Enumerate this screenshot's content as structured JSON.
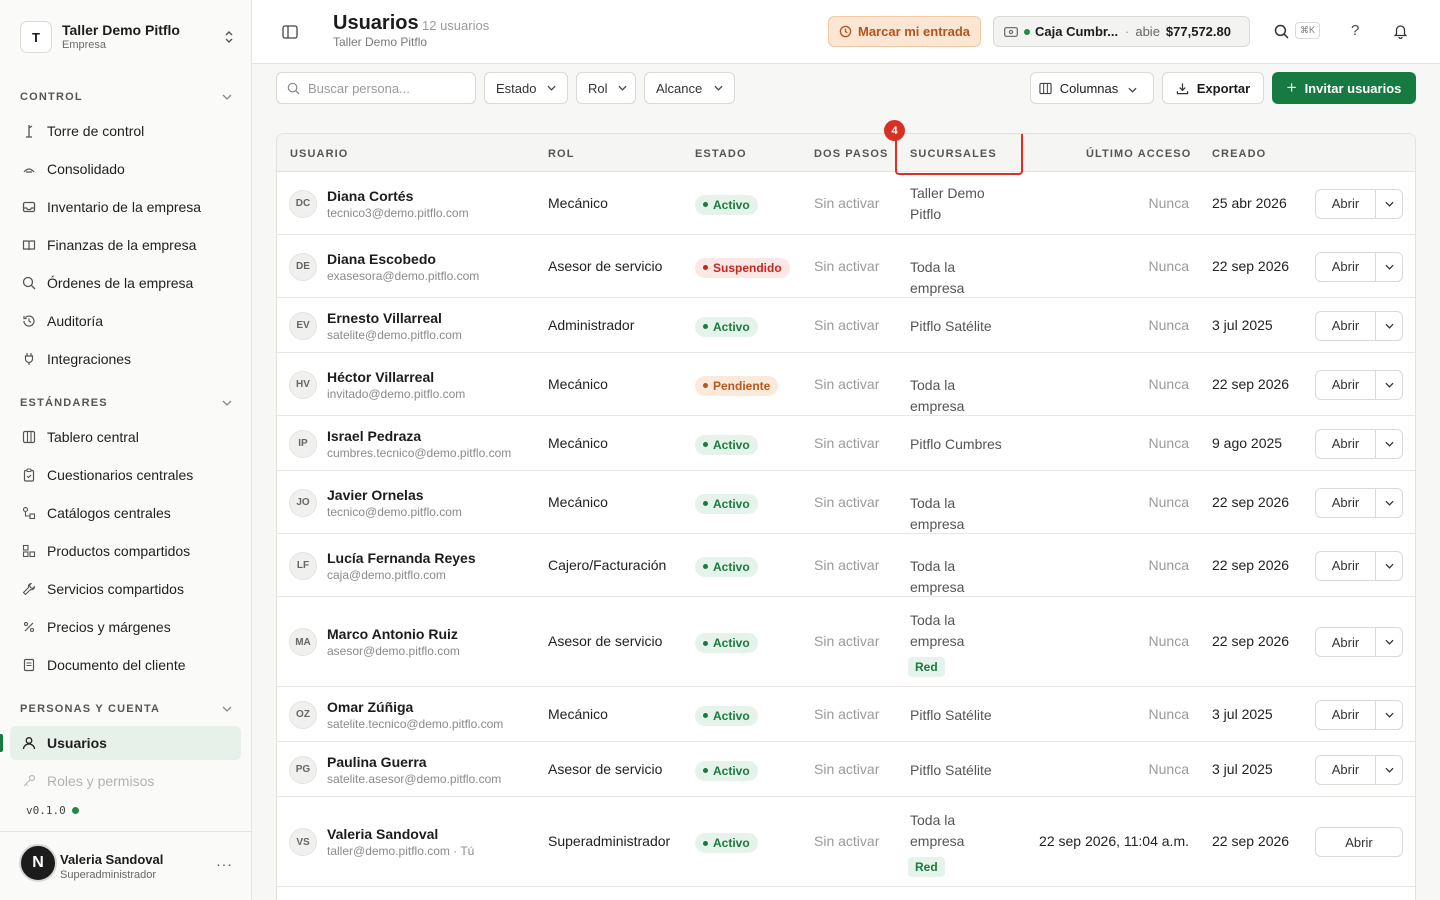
{
  "org": {
    "initial": "T",
    "name": "Taller Demo Pitflo",
    "sub": "Empresa"
  },
  "sections": [
    {
      "title": "CONTROL",
      "items": [
        "Torre de control",
        "Consolidado",
        "Inventario de la empresa",
        "Finanzas de la empresa",
        "Órdenes de la empresa",
        "Auditoría",
        "Integraciones"
      ]
    },
    {
      "title": "ESTÁNDARES",
      "items": [
        "Tablero central",
        "Cuestionarios centrales",
        "Catálogos centrales",
        "Productos compartidos",
        "Servicios compartidos",
        "Precios y márgenes",
        "Documento del cliente"
      ]
    },
    {
      "title": "PERSONAS Y CUENTA",
      "items": [
        "Usuarios",
        "Roles y permisos"
      ]
    }
  ],
  "icons": {
    "control": [
      "tower-icon",
      "layers-icon",
      "inbox-icon",
      "book-icon",
      "search-icon",
      "history-icon",
      "plug-icon"
    ],
    "estandares": [
      "layout-icon",
      "clipboard-icon",
      "catalog-icon",
      "products-icon",
      "wrench-icon",
      "percent-icon",
      "document-icon"
    ],
    "personas": [
      "user-icon",
      "key-icon"
    ]
  },
  "version": "v0.1.0",
  "current_user": {
    "initial": "N",
    "name": "Valeria Sandoval",
    "role": "Superadministrador",
    "more": "···"
  },
  "header": {
    "title": "Usuarios",
    "count": "12 usuarios",
    "crumb": "Taller Demo Pitflo",
    "clock_label": "Marcar mi entrada",
    "caja_name": "Caja Cumbr...",
    "caja_sep": "·",
    "caja_state": "abie",
    "caja_amount": "$77,572.80",
    "kbd": "⌘K",
    "help": "?"
  },
  "toolbar": {
    "search_placeholder": "Buscar persona...",
    "filters": [
      "Estado",
      "Rol",
      "Alcance"
    ],
    "columns_label": "Columnas",
    "export_label": "Exportar",
    "invite_label": "Invitar usuarios",
    "invite_plus": "+"
  },
  "table": {
    "headers": [
      "USUARIO",
      "ROL",
      "ESTADO",
      "DOS PASOS",
      "SUCURSALES",
      "ÚLTIMO ACCESO",
      "CREADO"
    ],
    "highlight_number": "4",
    "open_label": "Abrir",
    "rows": [
      {
        "initials": "DC",
        "name": "Diana Cortés",
        "email": "tecnico3@demo.pitflo.com",
        "role": "Mecánico",
        "status": "Activo",
        "twofa": "Sin activar",
        "branch": "Taller Demo Pitflo",
        "tag": "",
        "last": "Nunca",
        "created": "25 abr 2026"
      },
      {
        "initials": "DE",
        "name": "Diana Escobedo",
        "email": "exasesora@demo.pitflo.com",
        "role": "Asesor de servicio",
        "status": "Suspendido",
        "twofa": "Sin activar",
        "branch": "Toda la empresa",
        "tag": "",
        "last": "Nunca",
        "created": "22 sep 2026"
      },
      {
        "initials": "EV",
        "name": "Ernesto Villarreal",
        "email": "satelite@demo.pitflo.com",
        "role": "Administrador",
        "status": "Activo",
        "twofa": "Sin activar",
        "branch": "Pitflo Satélite",
        "tag": "",
        "last": "Nunca",
        "created": "3 jul 2025"
      },
      {
        "initials": "HV",
        "name": "Héctor Villarreal",
        "email": "invitado@demo.pitflo.com",
        "role": "Mecánico",
        "status": "Pendiente",
        "twofa": "Sin activar",
        "branch": "Toda la empresa",
        "tag": "",
        "last": "Nunca",
        "created": "22 sep 2026"
      },
      {
        "initials": "IP",
        "name": "Israel Pedraza",
        "email": "cumbres.tecnico@demo.pitflo.com",
        "role": "Mecánico",
        "status": "Activo",
        "twofa": "Sin activar",
        "branch": "Pitflo Cumbres",
        "tag": "",
        "last": "Nunca",
        "created": "9 ago 2025"
      },
      {
        "initials": "JO",
        "name": "Javier Ornelas",
        "email": "tecnico@demo.pitflo.com",
        "role": "Mecánico",
        "status": "Activo",
        "twofa": "Sin activar",
        "branch": "Toda la empresa",
        "tag": "",
        "last": "Nunca",
        "created": "22 sep 2026"
      },
      {
        "initials": "LF",
        "name": "Lucía Fernanda Reyes",
        "email": "caja@demo.pitflo.com",
        "role": "Cajero/Facturación",
        "status": "Activo",
        "twofa": "Sin activar",
        "branch": "Toda la empresa",
        "tag": "",
        "last": "Nunca",
        "created": "22 sep 2026"
      },
      {
        "initials": "MA",
        "name": "Marco Antonio Ruiz",
        "email": "asesor@demo.pitflo.com",
        "role": "Asesor de servicio",
        "status": "Activo",
        "twofa": "Sin activar",
        "branch": "Toda la empresa",
        "tag": "Red",
        "last": "Nunca",
        "created": "22 sep 2026"
      },
      {
        "initials": "OZ",
        "name": "Omar Zúñiga",
        "email": "satelite.tecnico@demo.pitflo.com",
        "role": "Mecánico",
        "status": "Activo",
        "twofa": "Sin activar",
        "branch": "Pitflo Satélite",
        "tag": "",
        "last": "Nunca",
        "created": "3 jul 2025"
      },
      {
        "initials": "PG",
        "name": "Paulina Guerra",
        "email": "satelite.asesor@demo.pitflo.com",
        "role": "Asesor de servicio",
        "status": "Activo",
        "twofa": "Sin activar",
        "branch": "Pitflo Satélite",
        "tag": "",
        "last": "Nunca",
        "created": "3 jul 2025"
      },
      {
        "initials": "VS",
        "name": "Valeria Sandoval",
        "email": "taller@demo.pitflo.com · Tú",
        "role": "Superadministrador",
        "status": "Activo",
        "twofa": "Sin activar",
        "branch": "Toda la empresa",
        "tag": "Red",
        "last": "22 sep 2026, 11:04 a.m.",
        "created": "22 sep 2026"
      }
    ]
  },
  "colors": {
    "accent": "#177a43",
    "highlight": "#d93025",
    "clock_bg": "#fbe5d3"
  }
}
